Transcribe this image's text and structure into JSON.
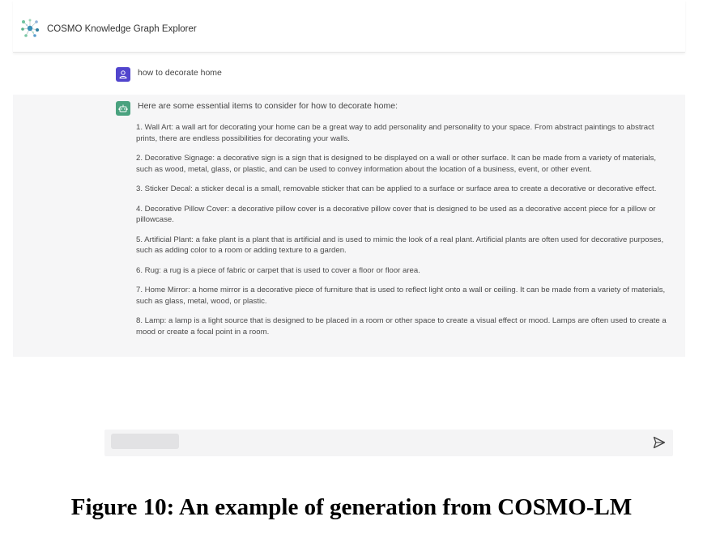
{
  "app": {
    "title": "COSMO Knowledge Graph Explorer",
    "logo_icon": "network-graph-icon"
  },
  "conversation": {
    "user_message": "how to decorate home",
    "assistant_intro": "Here are some essential items to consider for how to decorate home:",
    "assistant_items": [
      "1. Wall Art: a wall art for decorating your home can be a great way to add personality and personality to your space. From abstract paintings to abstract prints, there are endless possibilities for decorating your walls.",
      "2. Decorative Signage: a decorative sign is a sign that is designed to be displayed on a wall or other surface. It can be made from a variety of materials, such as wood, metal, glass, or plastic, and can be used to convey information about the location of a business, event, or other event.",
      "3. Sticker Decal: a sticker decal is a small, removable sticker that can be applied to a surface or surface area to create a decorative or decorative effect.",
      "4. Decorative Pillow Cover: a decorative pillow cover is a decorative pillow cover that is designed to be used as a decorative accent piece for a pillow or pillowcase.",
      "5. Artificial Plant: a fake plant is a plant that is artificial and is used to mimic the look of a real plant. Artificial plants are often used for decorative purposes, such as adding color to a room or adding texture to a garden.",
      "6. Rug: a rug is a piece of fabric or carpet that is used to cover a floor or floor area.",
      "7. Home Mirror: a home mirror is a decorative piece of furniture that is used to reflect light onto a wall or ceiling. It can be made from a variety of materials, such as glass, metal, wood, or plastic.",
      "8. Lamp: a lamp is a light source that is designed to be placed in a room or other space to create a visual effect or mood. Lamps are often used to create a mood or create a focal point in a room."
    ]
  },
  "input": {
    "value": "",
    "send_icon": "send-icon"
  },
  "colors": {
    "user_avatar": "#5145cd",
    "bot_avatar": "#4aa27f",
    "bot_background": "#f6f6f7"
  },
  "caption": "Figure 10: An example of generation from COSMO-LM"
}
